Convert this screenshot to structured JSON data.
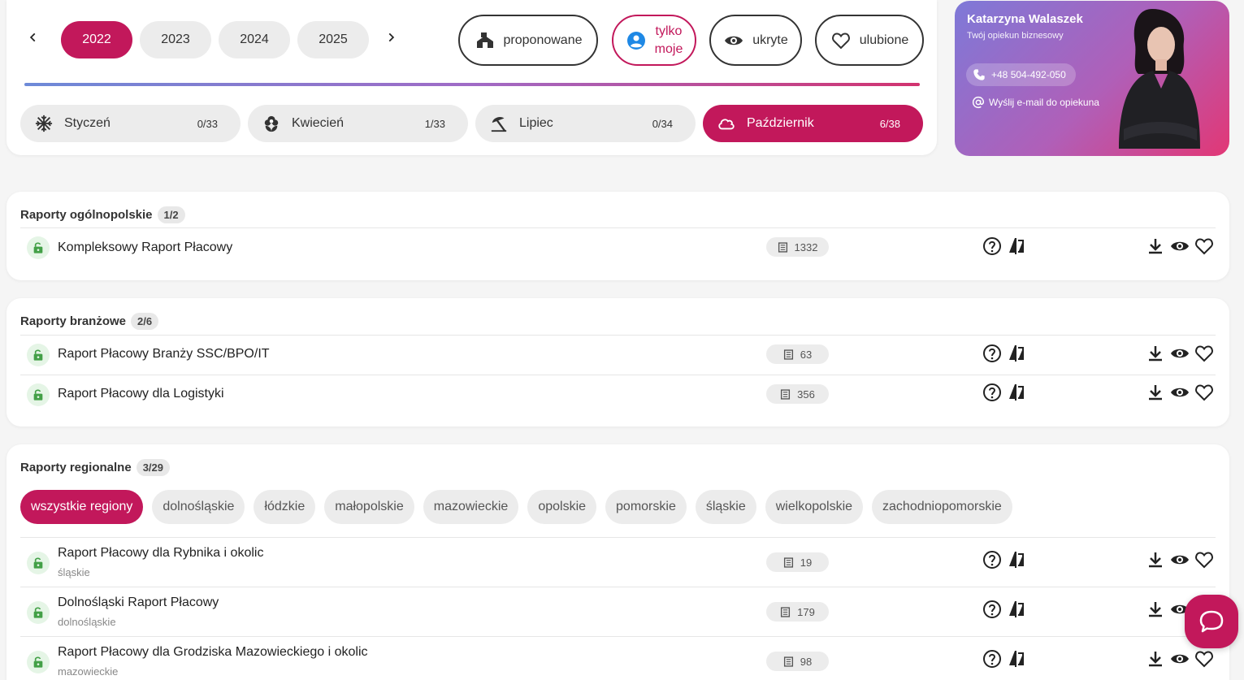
{
  "years": [
    "2022",
    "2023",
    "2024",
    "2025"
  ],
  "filters": {
    "proponowane": "proponowane",
    "tylko_line1": "tylko",
    "tylko_line2": "moje",
    "ukryte": "ukryte",
    "ulubione": "ulubione"
  },
  "months": [
    {
      "name": "Styczeń",
      "count": "0/33"
    },
    {
      "name": "Kwiecień",
      "count": "1/33"
    },
    {
      "name": "Lipiec",
      "count": "0/34"
    },
    {
      "name": "Październik",
      "count": "6/38"
    }
  ],
  "advisor": {
    "name": "Katarzyna Walaszek",
    "role": "Twój opiekun biznesowy",
    "phone": "+48 504-492-050",
    "mail": "Wyślij e-mail do opiekuna"
  },
  "sections": {
    "national": {
      "title": "Raporty ogólnopolskie",
      "count": "1/2",
      "rows": [
        {
          "title": "Kompleksowy Raport Płacowy",
          "pages": "1332"
        }
      ]
    },
    "industry": {
      "title": "Raporty branżowe",
      "count": "2/6",
      "rows": [
        {
          "title": "Raport Płacowy Branży SSC/BPO/IT",
          "pages": "63"
        },
        {
          "title": "Raport Płacowy dla Logistyki",
          "pages": "356"
        }
      ]
    },
    "regional": {
      "title": "Raporty regionalne",
      "count": "3/29",
      "regions": [
        "wszystkie regiony",
        "dolnośląskie",
        "łódzkie",
        "małopolskie",
        "mazowieckie",
        "opolskie",
        "pomorskie",
        "śląskie",
        "wielkopolskie",
        "zachodniopomorskie"
      ],
      "rows": [
        {
          "title": "Raport Płacowy dla Rybnika i okolic",
          "region": "śląskie",
          "pages": "19"
        },
        {
          "title": "Dolnośląski Raport Płacowy",
          "region": "dolnośląskie",
          "pages": "179"
        },
        {
          "title": "Raport Płacowy dla Grodziska Mazowieckiego i okolic",
          "region": "mazowieckie",
          "pages": "98"
        }
      ]
    }
  },
  "colors": {
    "accent": "#c2185b",
    "lock_bg": "#e5f5e6",
    "lock_icon": "#43a047"
  }
}
